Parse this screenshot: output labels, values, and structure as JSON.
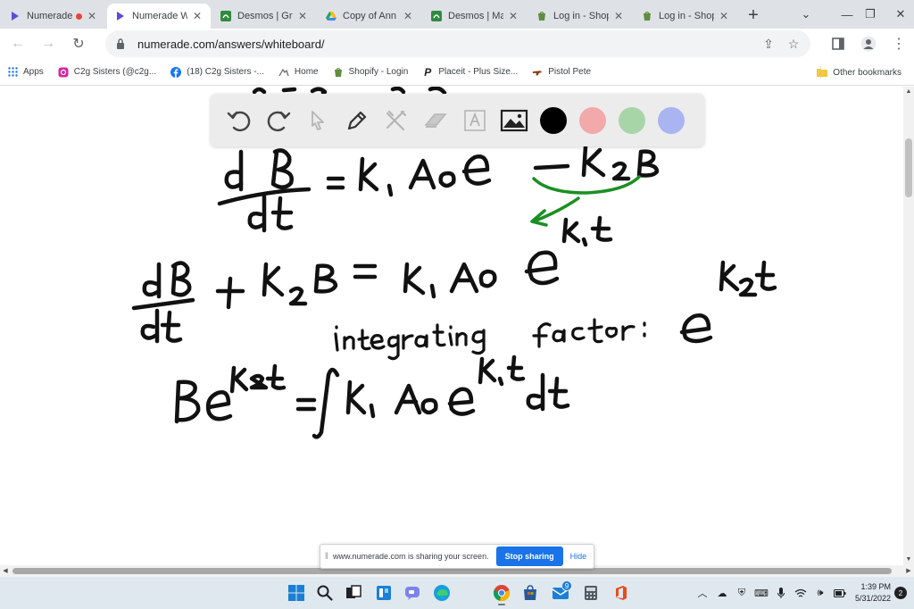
{
  "browser": {
    "tabs": [
      {
        "title": "Numerade",
        "favicon": "numerade-icon",
        "recording": true,
        "active": false
      },
      {
        "title": "Numerade Wh",
        "favicon": "numerade-icon",
        "recording": false,
        "active": true
      },
      {
        "title": "Desmos | Grap",
        "favicon": "desmos-icon",
        "recording": false,
        "active": false
      },
      {
        "title": "Copy of Ann X",
        "favicon": "google-drive-icon",
        "recording": false,
        "active": false
      },
      {
        "title": "Desmos | Matr",
        "favicon": "desmos-icon",
        "recording": false,
        "active": false
      },
      {
        "title": "Log in - Shopif",
        "favicon": "shopify-icon",
        "recording": false,
        "active": false
      },
      {
        "title": "Log in - Shopif",
        "favicon": "shopify-icon",
        "recording": false,
        "active": false
      }
    ],
    "url": "numerade.com/answers/whiteboard/",
    "bookmarks": [
      {
        "label": "Apps",
        "icon": "apps-grid-icon"
      },
      {
        "label": "C2g Sisters (@c2g...",
        "icon": "instagram-icon"
      },
      {
        "label": "(18) C2g Sisters -...",
        "icon": "facebook-icon"
      },
      {
        "label": "Home",
        "icon": "home-bookmark-icon"
      },
      {
        "label": "Shopify - Login",
        "icon": "shopify-icon"
      },
      {
        "label": "Placeit - Plus Size...",
        "icon": "placeit-icon"
      },
      {
        "label": "Pistol Pete",
        "icon": "pistol-pete-icon"
      }
    ],
    "other_bookmarks": "Other bookmarks"
  },
  "whiteboard": {
    "tools": [
      "undo-icon",
      "redo-icon",
      "select-pointer-icon",
      "pen-icon",
      "shapes-tool-icon",
      "eraser-icon",
      "text-tool-icon",
      "image-icon"
    ],
    "colors": [
      "#000000",
      "#f2a9a9",
      "#a8d5a8",
      "#a9b4f0"
    ],
    "selected_color": "#000000",
    "handwriting": [
      "dB/dt = k1 A0 e^(-k1 t) - K2 B",
      "dB/dt + K2 B = k1 A0 e^(-k1 t)",
      "integrating factor: e^(K2 t)",
      "B e^(K2 t) = ∫ K1 A0 e^(K1 t) dt"
    ]
  },
  "share_bar": {
    "message": "www.numerade.com is sharing your screen.",
    "stop_label": "Stop sharing",
    "hide_label": "Hide"
  },
  "taskbar": {
    "apps": [
      "windows-start-icon",
      "search-icon",
      "task-view-icon",
      "widgets-icon",
      "teams-chat-icon",
      "edge-icon",
      "chrome-icon",
      "store-icon",
      "mail-icon",
      "calculator-icon",
      "office-icon"
    ],
    "mail_badge": "9",
    "time": "1:39 PM",
    "date": "5/31/2022",
    "notifications": "2"
  }
}
